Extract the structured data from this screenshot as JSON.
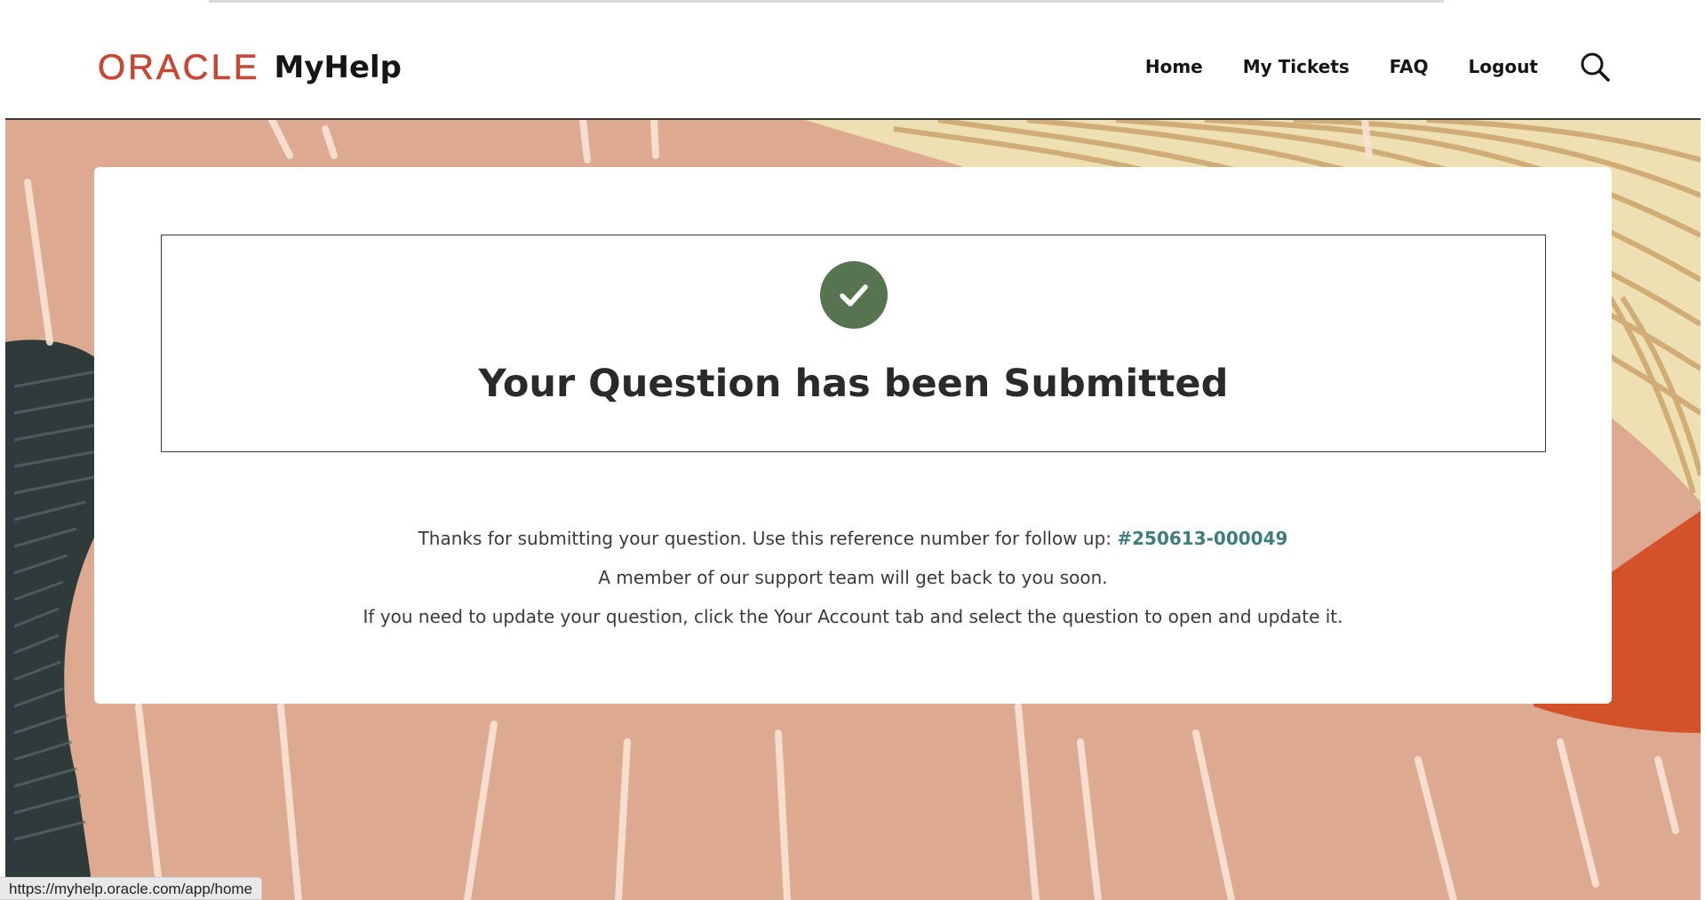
{
  "header": {
    "logo_brand": "ORACLE",
    "logo_product": "MyHelp",
    "nav": [
      {
        "label": "Home"
      },
      {
        "label": "My Tickets"
      },
      {
        "label": "FAQ"
      },
      {
        "label": "Logout"
      }
    ],
    "search_icon": "search-icon"
  },
  "confirmation": {
    "icon": "check-circle-icon",
    "title": "Your Question has been Submitted",
    "line1_prefix": "Thanks for submitting your question. Use this reference number for follow up: ",
    "reference_number": "#250613-000049",
    "line2": "A member of our support team will get back to you soon.",
    "line3": "If you need to update your question, click the Your Account tab and select the question to open and update it."
  },
  "status_bar": {
    "url": "https://myhelp.oracle.com/app/home"
  },
  "colors": {
    "brand_red": "#c74634",
    "success_green": "#55744f",
    "link_teal": "#3f7d7d",
    "bg_peach": "#dba58a",
    "bg_dark": "#2f3a3b",
    "bg_orange": "#d4522a",
    "bg_cream": "#efe0b4"
  }
}
